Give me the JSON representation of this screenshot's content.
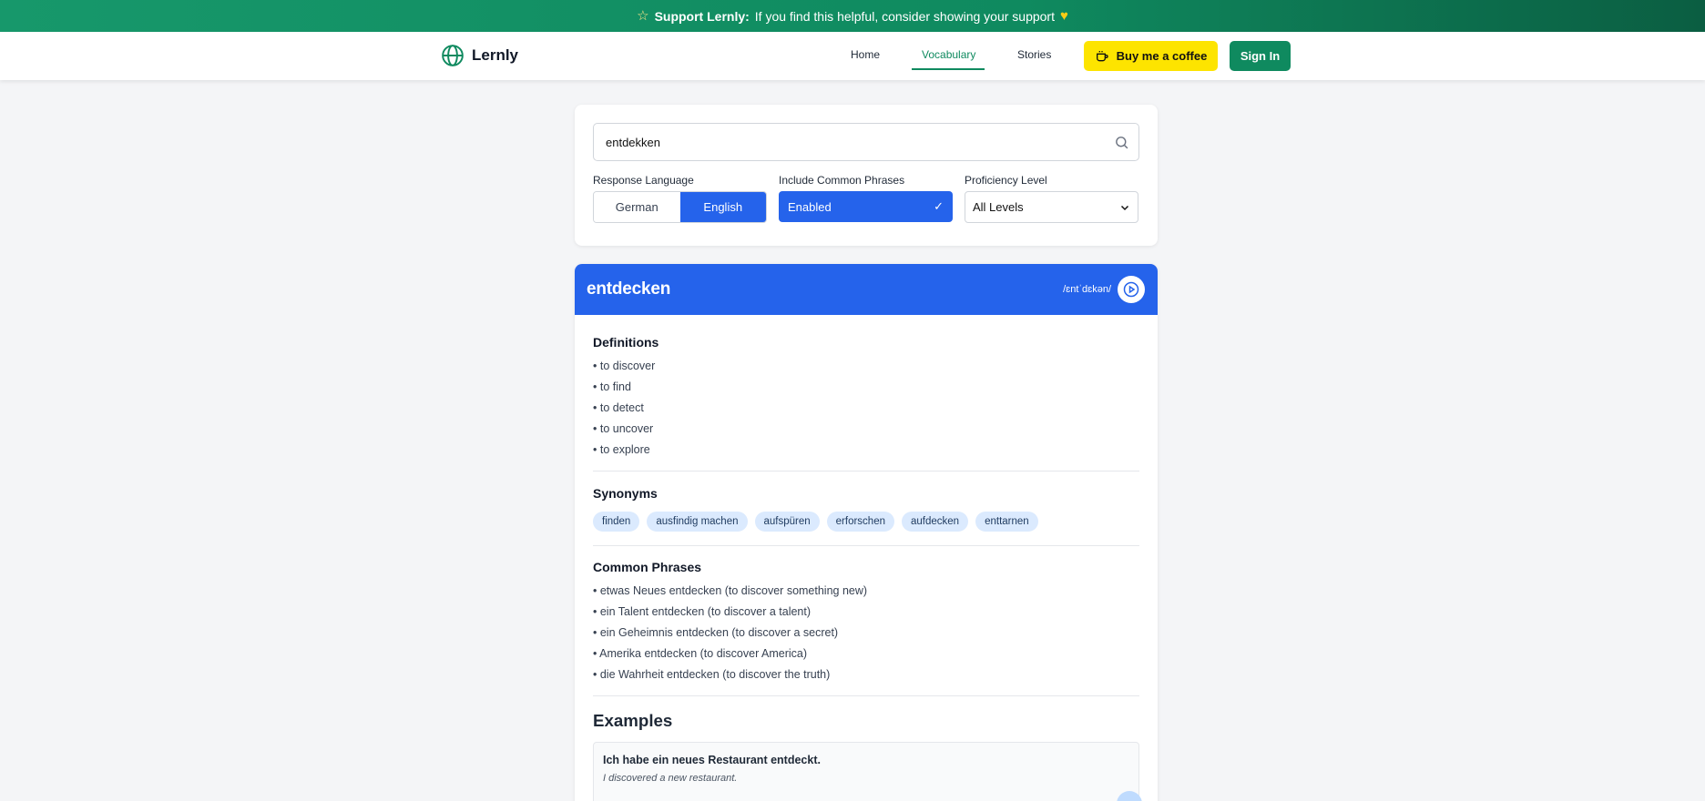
{
  "banner": {
    "bold": "Support Lernly:",
    "text": "If you find this helpful, consider showing your support"
  },
  "nav": {
    "brand": "Lernly",
    "links": [
      "Home",
      "Vocabulary",
      "Stories"
    ],
    "active": "Vocabulary",
    "coffee": "Buy me a coffee",
    "signin": "Sign In"
  },
  "search": {
    "value": "entdekken",
    "response_language_label": "Response Language",
    "languages": [
      "German",
      "English"
    ],
    "selected_language": "English",
    "phrases_label": "Include Common Phrases",
    "phrases_value": "Enabled",
    "proficiency_label": "Proficiency Level",
    "proficiency_value": "All Levels"
  },
  "word": {
    "title": "entdecken",
    "pronunciation": "/ɛntˈdɛkən/",
    "definitions_title": "Definitions",
    "definitions": [
      "• to discover",
      "• to find",
      "• to detect",
      "• to uncover",
      "• to explore"
    ],
    "synonyms_title": "Synonyms",
    "synonyms": [
      "finden",
      "ausfindig machen",
      "aufspüren",
      "erforschen",
      "aufdecken",
      "enttarnen"
    ],
    "phrases_title": "Common Phrases",
    "phrases": [
      "• etwas Neues entdecken (to discover something new)",
      "• ein Talent entdecken (to discover a talent)",
      "• ein Geheimnis entdecken (to discover a secret)",
      "• Amerika entdecken (to discover America)",
      "• die Wahrheit entdecken (to discover the truth)"
    ],
    "examples_title": "Examples",
    "examples": [
      {
        "de": "Ich habe ein neues Restaurant entdeckt.",
        "en": "I discovered a new restaurant."
      }
    ]
  },
  "colors": {
    "brand_green": "#0f8a5f",
    "primary_blue": "#2563eb",
    "coffee_yellow": "#fde400",
    "chip_bg": "#dbeafe"
  },
  "icons": [
    "star-icon",
    "heart-icon",
    "globe-logo-icon",
    "coffee-cup-icon",
    "search-icon",
    "check-icon",
    "chevron-down-icon",
    "play-icon"
  ]
}
